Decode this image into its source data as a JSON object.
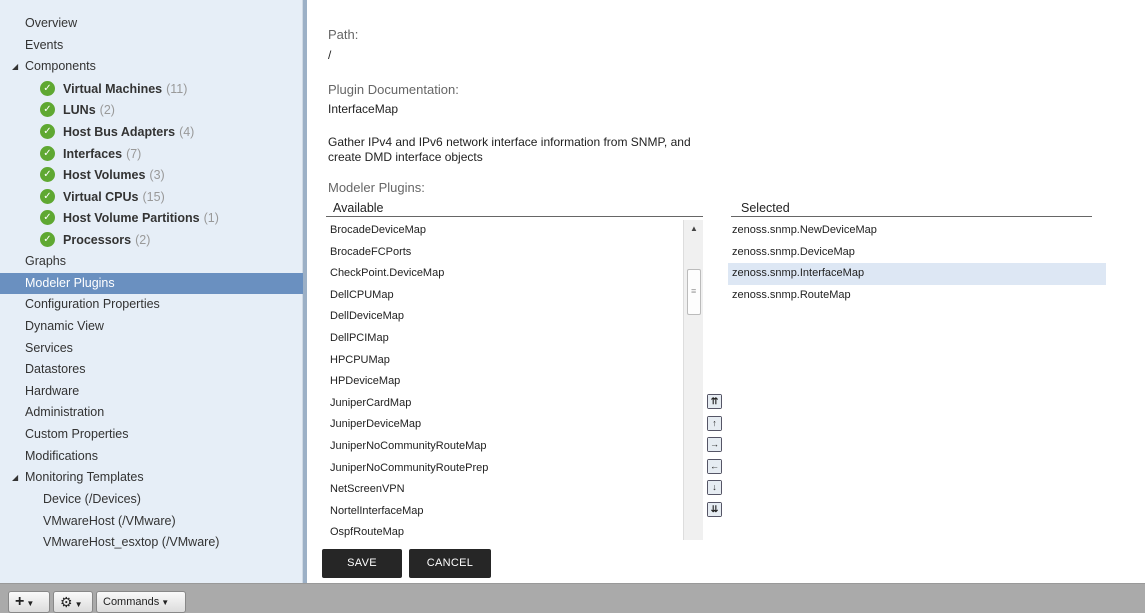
{
  "sidebar": {
    "items": [
      {
        "label": "Overview"
      },
      {
        "label": "Events"
      },
      {
        "label": "Components"
      },
      {
        "label": "Graphs"
      },
      {
        "label": "Modeler Plugins"
      },
      {
        "label": "Configuration Properties"
      },
      {
        "label": "Dynamic View"
      },
      {
        "label": "Services"
      },
      {
        "label": "Datastores"
      },
      {
        "label": "Hardware"
      },
      {
        "label": "Administration"
      },
      {
        "label": "Custom Properties"
      },
      {
        "label": "Modifications"
      },
      {
        "label": "Monitoring Templates"
      }
    ],
    "components": [
      {
        "name": "Virtual Machines",
        "count": "(11)"
      },
      {
        "name": "LUNs",
        "count": "(2)"
      },
      {
        "name": "Host Bus Adapters",
        "count": "(4)"
      },
      {
        "name": "Interfaces",
        "count": "(7)"
      },
      {
        "name": "Host Volumes",
        "count": "(3)"
      },
      {
        "name": "Virtual CPUs",
        "count": "(15)"
      },
      {
        "name": "Host Volume Partitions",
        "count": "(1)"
      },
      {
        "name": "Processors",
        "count": "(2)"
      }
    ],
    "templates": [
      {
        "label": "Device (/Devices)"
      },
      {
        "label": "VMwareHost (/VMware)"
      },
      {
        "label": "VMwareHost_esxtop (/VMware)"
      }
    ],
    "selected": "Modeler Plugins"
  },
  "main": {
    "path_label": "Path:",
    "path_value": "/",
    "doc_label": "Plugin Documentation:",
    "doc_value": "InterfaceMap",
    "description_line1": "Gather IPv4 and IPv6 network interface information from SNMP, and",
    "description_line2": "create DMD interface objects",
    "modeler_label": "Modeler Plugins:",
    "available_header": "Available",
    "selected_header": "Selected",
    "available": [
      "BrocadeDeviceMap",
      "BrocadeFCPorts",
      "CheckPoint.DeviceMap",
      "DellCPUMap",
      "DellDeviceMap",
      "DellPCIMap",
      "HPCPUMap",
      "HPDeviceMap",
      "JuniperCardMap",
      "JuniperDeviceMap",
      "JuniperNoCommunityRouteMap",
      "JuniperNoCommunityRoutePrep",
      "NetScreenVPN",
      "NortelInterfaceMap",
      "OspfRouteMap"
    ],
    "selected": [
      "zenoss.snmp.NewDeviceMap",
      "zenoss.snmp.DeviceMap",
      "zenoss.snmp.InterfaceMap",
      "zenoss.snmp.RouteMap"
    ],
    "highlighted_selected": "zenoss.snmp.InterfaceMap",
    "save_label": "SAVE",
    "cancel_label": "CANCEL"
  },
  "toolbar": {
    "add_glyph": "+",
    "gear_glyph": "⚙",
    "commands_label": "Commands"
  },
  "colors": {
    "sidebar_bg": "#e6eef7",
    "selected_nav": "#6a90c0",
    "status_ok": "#5fa832",
    "button_bg": "#262626",
    "toolbar_bg": "#aaaaaa"
  }
}
